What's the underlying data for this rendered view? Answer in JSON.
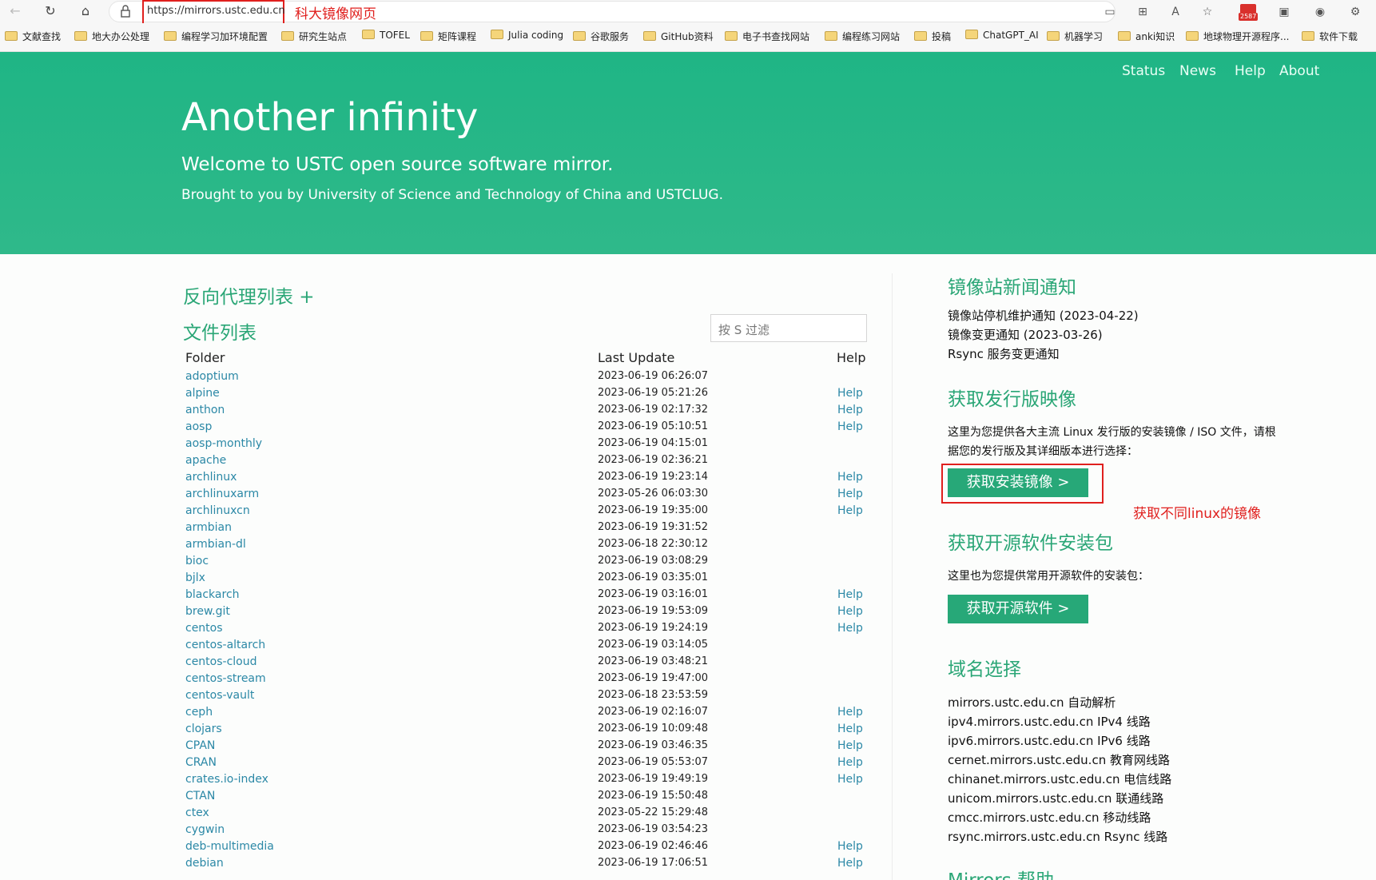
{
  "browser": {
    "url": "https://mirrors.ustc.edu.cn",
    "url_annotation": "科大镜像网页",
    "mail_count": "2587"
  },
  "bookmarks": [
    "文献查找",
    "地大办公处理",
    "编程学习加环境配置",
    "研究生站点",
    "TOFEL",
    "矩阵课程",
    "Julia coding",
    "谷歌服务",
    "GitHub资料",
    "电子书查找网站",
    "编程练习网站",
    "投稿",
    "ChatGPT_AI",
    "机器学习",
    "anki知识",
    "地球物理开源程序...",
    "软件下载"
  ],
  "nav": {
    "status": "Status",
    "news": "News",
    "help": "Help",
    "about": "About"
  },
  "hero": {
    "title": "Another infinity",
    "subtitle": "Welcome to USTC open source software mirror.",
    "tagline": "Brought to you by University of Science and Technology of China and USTCLUG."
  },
  "left": {
    "proxy_title": "反向代理列表 +",
    "files_title": "文件列表",
    "filter_placeholder": "按 S 过滤",
    "col_folder": "Folder",
    "col_update": "Last Update",
    "col_help": "Help",
    "rows": [
      {
        "name": "adoptium",
        "date": "2023-06-19 06:26:07",
        "help": ""
      },
      {
        "name": "alpine",
        "date": "2023-06-19 05:21:26",
        "help": "Help"
      },
      {
        "name": "anthon",
        "date": "2023-06-19 02:17:32",
        "help": "Help"
      },
      {
        "name": "aosp",
        "date": "2023-06-19 05:10:51",
        "help": "Help"
      },
      {
        "name": "aosp-monthly",
        "date": "2023-06-19 04:15:01",
        "help": ""
      },
      {
        "name": "apache",
        "date": "2023-06-19 02:36:21",
        "help": ""
      },
      {
        "name": "archlinux",
        "date": "2023-06-19 19:23:14",
        "help": "Help"
      },
      {
        "name": "archlinuxarm",
        "date": "2023-05-26 06:03:30",
        "help": "Help"
      },
      {
        "name": "archlinuxcn",
        "date": "2023-06-19 19:35:00",
        "help": "Help"
      },
      {
        "name": "armbian",
        "date": "2023-06-19 19:31:52",
        "help": ""
      },
      {
        "name": "armbian-dl",
        "date": "2023-06-18 22:30:12",
        "help": ""
      },
      {
        "name": "bioc",
        "date": "2023-06-19 03:08:29",
        "help": ""
      },
      {
        "name": "bjlx",
        "date": "2023-06-19 03:35:01",
        "help": ""
      },
      {
        "name": "blackarch",
        "date": "2023-06-19 03:16:01",
        "help": "Help"
      },
      {
        "name": "brew.git",
        "date": "2023-06-19 19:53:09",
        "help": "Help"
      },
      {
        "name": "centos",
        "date": "2023-06-19 19:24:19",
        "help": "Help"
      },
      {
        "name": "centos-altarch",
        "date": "2023-06-19 03:14:05",
        "help": ""
      },
      {
        "name": "centos-cloud",
        "date": "2023-06-19 03:48:21",
        "help": ""
      },
      {
        "name": "centos-stream",
        "date": "2023-06-19 19:47:00",
        "help": ""
      },
      {
        "name": "centos-vault",
        "date": "2023-06-18 23:53:59",
        "help": ""
      },
      {
        "name": "ceph",
        "date": "2023-06-19 02:16:07",
        "help": "Help"
      },
      {
        "name": "clojars",
        "date": "2023-06-19 10:09:48",
        "help": "Help"
      },
      {
        "name": "CPAN",
        "date": "2023-06-19 03:46:35",
        "help": "Help"
      },
      {
        "name": "CRAN",
        "date": "2023-06-19 05:53:07",
        "help": "Help"
      },
      {
        "name": "crates.io-index",
        "date": "2023-06-19 19:49:19",
        "help": "Help"
      },
      {
        "name": "CTAN",
        "date": "2023-06-19 15:50:48",
        "help": ""
      },
      {
        "name": "ctex",
        "date": "2023-05-22 15:29:48",
        "help": ""
      },
      {
        "name": "cygwin",
        "date": "2023-06-19 03:54:23",
        "help": ""
      },
      {
        "name": "deb-multimedia",
        "date": "2023-06-19 02:46:46",
        "help": "Help"
      },
      {
        "name": "debian",
        "date": "2023-06-19 17:06:51",
        "help": "Help"
      }
    ]
  },
  "right": {
    "news_title": "镜像站新闻通知",
    "news": [
      "镜像站停机维护通知 (2023-04-22)",
      "镜像变更通知 (2023-03-26)",
      "Rsync 服务变更通知"
    ],
    "iso_title": "获取发行版映像",
    "iso_desc1": "这里为您提供各大主流 Linux 发行版的安装镜像 / ISO 文件，请根",
    "iso_desc2": "据您的发行版及其详细版本进行选择：",
    "iso_button": "获取安装镜像 >",
    "iso_annotation": "获取不同linux的镜像",
    "software_title": "获取开源软件安装包",
    "software_desc": "这里也为您提供常用开源软件的安装包：",
    "software_button": "获取开源软件 >",
    "domain_title": "域名选择",
    "domains": [
      "mirrors.ustc.edu.cn 自动解析",
      "ipv4.mirrors.ustc.edu.cn IPv4 线路",
      "ipv6.mirrors.ustc.edu.cn IPv6 线路",
      "cernet.mirrors.ustc.edu.cn 教育网线路",
      "chinanet.mirrors.ustc.edu.cn 电信线路",
      "unicom.mirrors.ustc.edu.cn 联通线路",
      "cmcc.mirrors.ustc.edu.cn 移动线路",
      "rsync.mirrors.ustc.edu.cn Rsync 线路"
    ],
    "help_title": "Mirrors 帮助"
  }
}
